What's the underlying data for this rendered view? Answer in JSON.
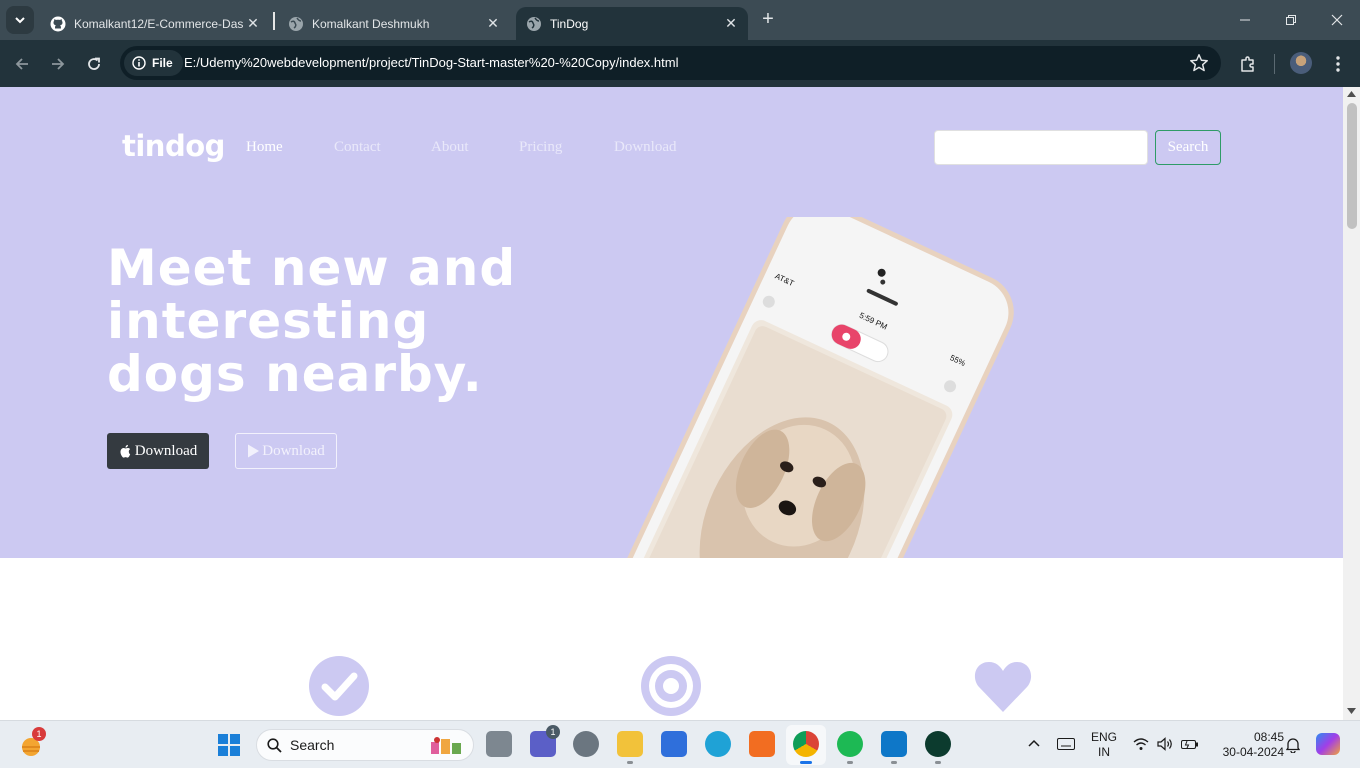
{
  "browser": {
    "tabs": [
      {
        "title": "Komalkant12/E-Commerce-Das",
        "icon": "github-icon"
      },
      {
        "title": "Komalkant Deshmukh",
        "icon": "globe-icon"
      },
      {
        "title": "TinDog",
        "icon": "globe-icon",
        "active": true
      }
    ],
    "site_chip": "File",
    "url": "E:/Udemy%20webdevelopment/project/TinDog-Start-master%20-%20Copy/index.html"
  },
  "page": {
    "brand": "tindog",
    "nav": [
      "Home",
      "Contact",
      "About",
      "Pricing",
      "Download"
    ],
    "search_button": "Search",
    "headline": "Meet new and interesting dogs nearby.",
    "download_apple": "Download",
    "download_play": "Download",
    "phone": {
      "carrier": "AT&T",
      "time": "5:59 PM",
      "battery": "55%"
    },
    "feature_icons": [
      "check-circle-icon",
      "bullseye-icon",
      "heart-icon"
    ],
    "colors": {
      "hero_bg": "#ccc9f2",
      "feature_icon": "#ccc9f2",
      "dark_button": "#343a40",
      "search_border": "#2e9b67"
    }
  },
  "taskbar": {
    "search_label": "Search",
    "weather_badge": "1",
    "teams_badge": "1",
    "lang_line1": "ENG",
    "lang_line2": "IN",
    "time": "08:45",
    "date": "30-04-2024"
  }
}
